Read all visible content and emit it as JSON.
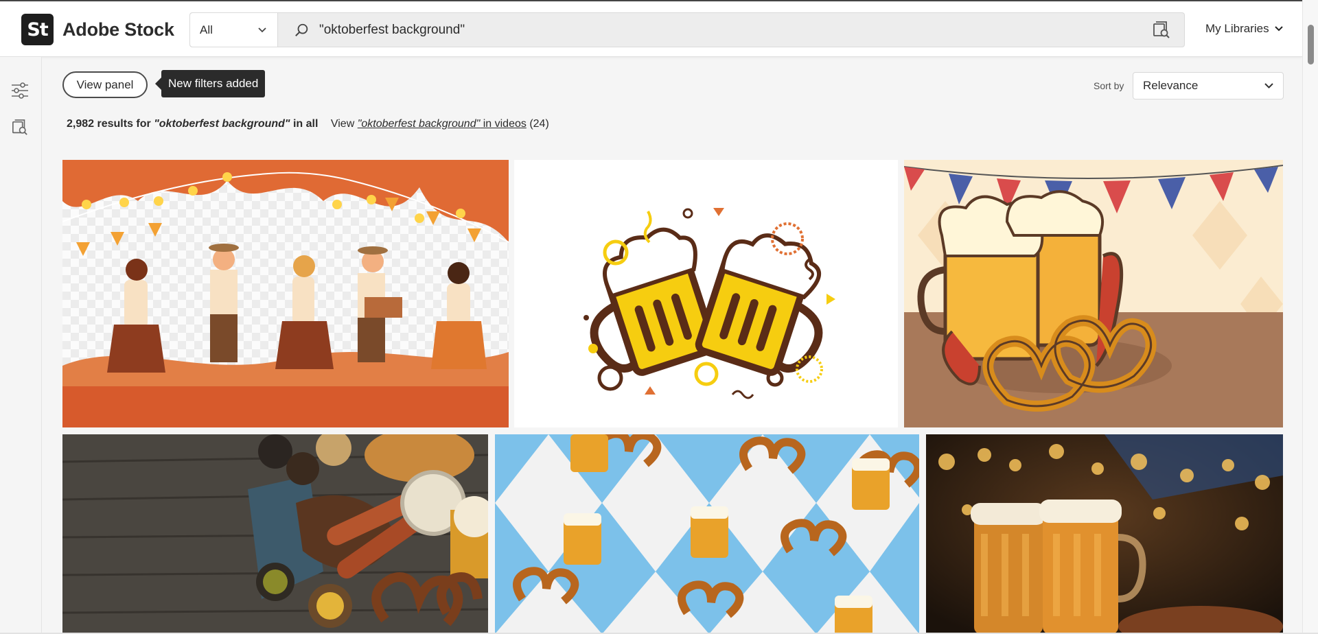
{
  "header": {
    "logo_badge": "St",
    "logo_text": "Adobe Stock",
    "scope_value": "All",
    "search_value": "\"oktoberfest background\"",
    "libraries_label": "My Libraries"
  },
  "toolbar": {
    "view_panel_label": "View panel",
    "tooltip_text": "New filters added",
    "sort_label": "Sort by",
    "sort_value": "Relevance"
  },
  "results": {
    "count": "2,982",
    "results_for": " results for ",
    "query": "\"oktoberfest background\"",
    "in_all": " in all",
    "view_prefix": "View ",
    "video_query": "\"oktoberfest background\"",
    "in_videos": " in videos",
    "video_count": " (24)"
  },
  "grid": {
    "items": [
      "Oktoberfest dancers illustration",
      "Cheering beer mugs illustration",
      "Beer mugs with pretzels and sausages",
      "Pretzels, sausages and beer on wooden table",
      "Beer and pretzel pattern on blue diamonds",
      "Beer mugs with bokeh lights"
    ]
  },
  "colors": {
    "accent_orange": "#e07033",
    "dark": "#1e1e1e",
    "blue_diamond": "#7cc1ea"
  },
  "icons": [
    "filter-icon",
    "visual-search-icon",
    "search-icon",
    "chevron-down-icon"
  ]
}
